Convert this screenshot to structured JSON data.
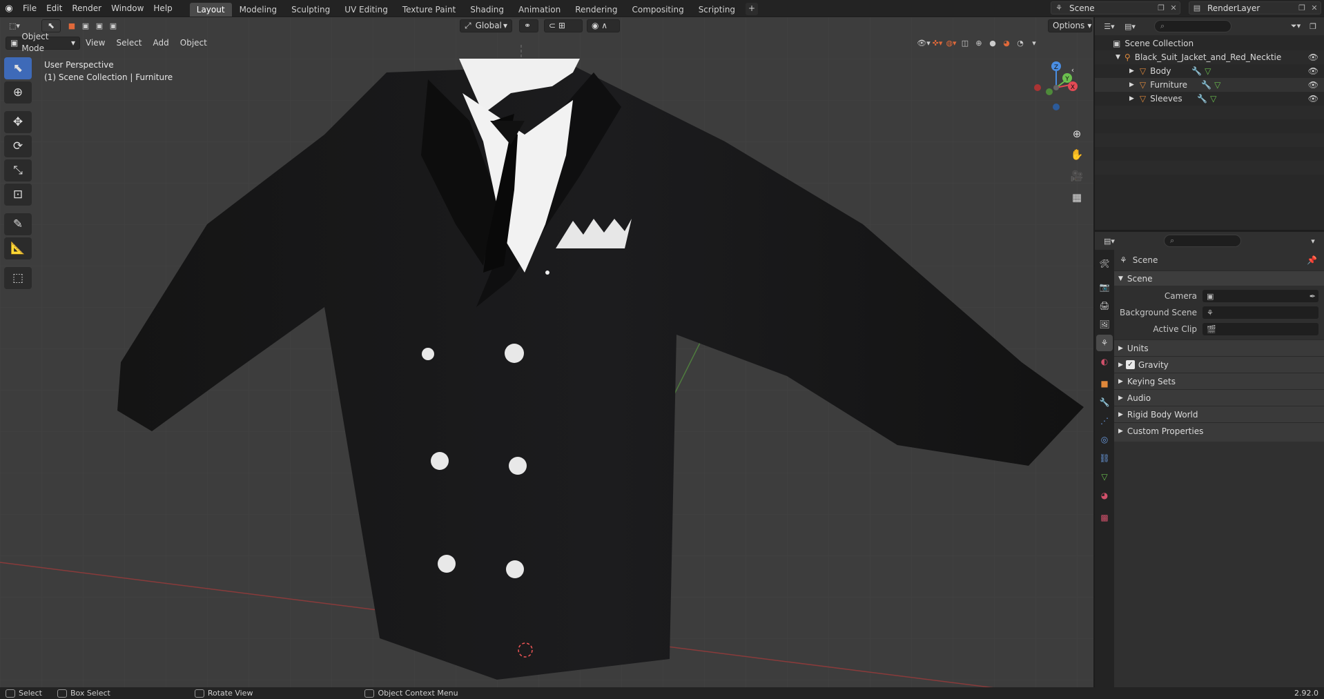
{
  "topbar": {
    "menus": [
      "File",
      "Edit",
      "Render",
      "Window",
      "Help"
    ],
    "workspaces": [
      "Layout",
      "Modeling",
      "Sculpting",
      "UV Editing",
      "Texture Paint",
      "Shading",
      "Animation",
      "Rendering",
      "Compositing",
      "Scripting"
    ],
    "active_workspace": "Layout",
    "scene_name": "Scene",
    "view_layer": "RenderLayer"
  },
  "viewport": {
    "mode": "Object Mode",
    "menus": [
      "View",
      "Select",
      "Add",
      "Object"
    ],
    "orientation": "Global",
    "options_label": "Options",
    "info_line1": "User Perspective",
    "info_line2": "(1) Scene Collection | Furniture",
    "gizmo": {
      "x": "X",
      "y": "Y",
      "z": "Z"
    }
  },
  "outliner": {
    "root": "Scene Collection",
    "collection": "Black_Suit_Jacket_and_Red_Necktie",
    "objects": [
      "Body",
      "Furniture",
      "Sleeves"
    ]
  },
  "properties": {
    "context_title": "Scene",
    "section_title": "Scene",
    "fields": [
      {
        "label": "Camera"
      },
      {
        "label": "Background Scene"
      },
      {
        "label": "Active Clip"
      }
    ],
    "subpanels": [
      "Units",
      "Gravity",
      "Keying Sets",
      "Audio",
      "Rigid Body World",
      "Custom Properties"
    ]
  },
  "statusbar": {
    "select": "Select",
    "box_select": "Box Select",
    "rotate": "Rotate View",
    "context_menu": "Object Context Menu",
    "version": "2.92.0"
  },
  "colors": {
    "accent": "#4772b3",
    "active_tool": "#3e6ab8",
    "axis_x": "#e34a55",
    "axis_y": "#6bbf4e",
    "axis_z": "#4a8ee3"
  }
}
